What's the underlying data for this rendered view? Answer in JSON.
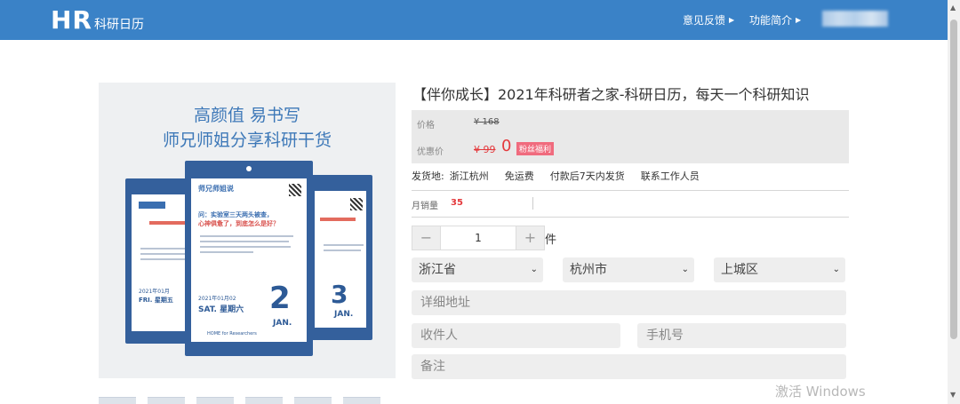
{
  "header": {
    "logo_hr": "HR",
    "logo_sub": "科研日历",
    "nav": [
      {
        "label": "意见反馈"
      },
      {
        "label": "功能简介"
      }
    ]
  },
  "product_image": {
    "promo_line1": "高颜值 易书写",
    "promo_line2": "师兄师姐分享科研干货",
    "card_left": {
      "date": "2021年01月",
      "day": "FRI. 星期五"
    },
    "card_center": {
      "header": "师兄师姐说",
      "question": "问：实验室三天两头被查，",
      "question2": "心神俱惫了，到底怎么是好？",
      "date": "2021年01月02",
      "day": "SAT. 星期六",
      "number": "2",
      "month": "JAN.",
      "footer": "HOME for Researchers"
    },
    "card_right": {
      "number": "3",
      "month": "JAN."
    }
  },
  "product": {
    "title": "【伴你成长】2021年科研者之家-科研日历，每天一个科研知识",
    "price_label": "价格",
    "original_price": "¥ 168",
    "sale_label": "优惠价",
    "sale_old": "¥ 99",
    "sale_new": "0",
    "badge": "粉丝福利",
    "shipping": {
      "label": "发货地:",
      "origin": "浙江杭州",
      "free": "免运费",
      "timing": "付款后7天内发货",
      "contact": "联系工作人员"
    },
    "sales_label": "月销量",
    "sales_count": "35"
  },
  "order_form": {
    "minus": "−",
    "quantity": "1",
    "plus": "+",
    "unit": "件",
    "province": "浙江省",
    "city": "杭州市",
    "district": "上城区",
    "address_placeholder": "详细地址",
    "recipient_placeholder": "收件人",
    "phone_placeholder": "手机号",
    "note_placeholder": "备注"
  },
  "os_watermark": "激活 Windows"
}
